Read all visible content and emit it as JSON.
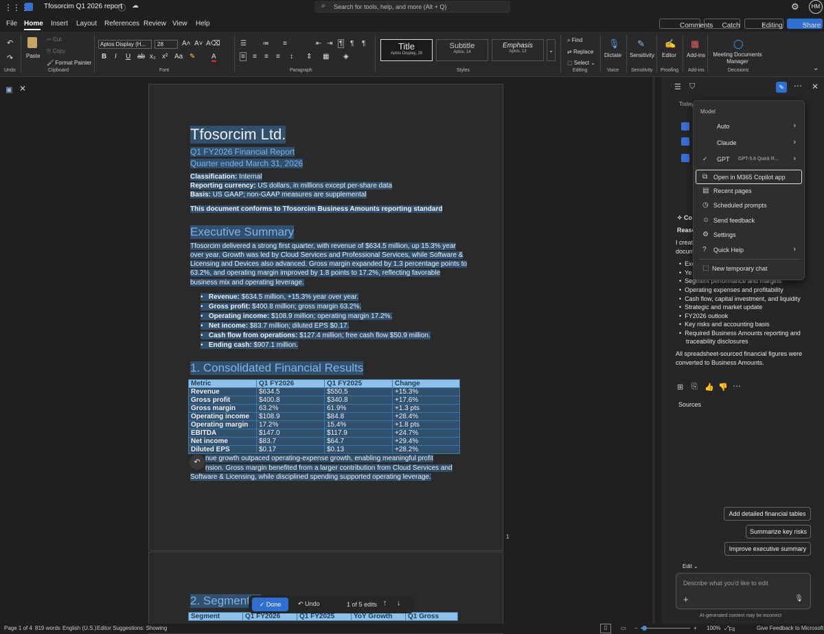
{
  "app": {
    "title": "Tfosorcim Q1 2026 report",
    "search_placeholder": "Search for tools, help, and more (Alt + Q)",
    "user_initials": "HM"
  },
  "menu": {
    "tabs": [
      "File",
      "Home",
      "Insert",
      "Layout",
      "References",
      "Review",
      "View",
      "Help"
    ],
    "comments": "Comments",
    "catch_up": "Catch up",
    "editing": "Editing",
    "share": "Share"
  },
  "ribbon": {
    "undo": "Undo",
    "paste": "Paste",
    "cut": "Cut",
    "copy": "Copy",
    "format_painter": "Format Painter",
    "clipboard": "Clipboard",
    "font_name": "Aptos Display (H...",
    "font_size": "28",
    "font": "Font",
    "paragraph": "Paragraph",
    "style_title": "Title",
    "style_title_sub": "Aptos Display, 28",
    "style_subtitle": "Subtitle",
    "style_subtitle_sub": "Aptos, 14",
    "style_emphasis": "Emphasis",
    "style_emphasis_sub": "Aptos, 12",
    "styles": "Styles",
    "find": "Find",
    "replace": "Replace",
    "select": "Select",
    "editing": "Editing",
    "dictate": "Dictate",
    "voice": "Voice",
    "sensitivity": "Sensitivity",
    "sensitivity_grp": "Sensitivity",
    "editor": "Editor",
    "proofing": "Proofing",
    "addins": "Add-ins",
    "addins_grp": "Add-ins",
    "meeting": "Meeting Documents Manager",
    "decisions": "Decisions"
  },
  "doc": {
    "title": "Tfosorcim Ltd.",
    "subtitle1": "Q1 FY2026 Financial Report",
    "subtitle2": "Quarter ended March 31, 2026",
    "meta": [
      {
        "k": "Classification:",
        "v": " Internal"
      },
      {
        "k": "Reporting currency:",
        "v": " US dollars, in millions except per-share data"
      },
      {
        "k": "Basis:",
        "v": " US GAAP; non-GAAP measures are supplemental"
      }
    ],
    "conform": "This document conforms to Tfosorcim Business Amounts reporting standard",
    "h_exec": "Executive Summary",
    "exec_lines": [
      "Tfosorcim delivered a strong first quarter, with revenue of $634.5 million, up 15.3% year",
      "over year. Growth was led by Cloud Services and Professional Services, while Software &",
      "Licensing and Devices also advanced. Gross margin expanded by 1.3 percentage points to",
      "63.2%, and operating margin improved by 1.8 points to 17.2%, reflecting favorable",
      "business mix and operating leverage."
    ],
    "bullets": [
      {
        "k": "Revenue:",
        "v": " $634.5 million, +15.3% year over year."
      },
      {
        "k": "Gross profit:",
        "v": " $400.8 million; gross margin 63.2%."
      },
      {
        "k": "Operating income:",
        "v": " $108.9 million; operating margin 17.2%."
      },
      {
        "k": "Net income:",
        "v": " $83.7 million; diluted EPS $0.17."
      },
      {
        "k": "Cash flow from operations:",
        "v": " $127.4 million; free cash flow $50.9 million."
      },
      {
        "k": "Ending cash:",
        "v": " $907.1 million."
      }
    ],
    "h_cons": "1. Consolidated Financial Results",
    "table_header": [
      "Metric",
      "Q1 FY2026",
      "Q1 FY2025",
      "Change"
    ],
    "table_rows": [
      [
        "Revenue",
        "$634.5",
        "$550.5",
        "+15.3%"
      ],
      [
        "Gross profit",
        "$400.8",
        "$340.8",
        "+17.6%"
      ],
      [
        "Gross margin",
        "63.2%",
        "61.9%",
        "+1.3 pts"
      ],
      [
        "Operating income",
        "$108.9",
        "$84.8",
        "+28.4%"
      ],
      [
        "Operating margin",
        "17.2%",
        "15.4%",
        "+1.8 pts"
      ],
      [
        "EBITDA",
        "$147.0",
        "$117.9",
        "+24.7%"
      ],
      [
        "Net income",
        "$83.7",
        "$64.7",
        "+29.4%"
      ],
      [
        "Diluted EPS",
        "$0.17",
        "$0.13",
        "+28.2%"
      ]
    ],
    "after_lines": [
      "nue growth outpaced operating-expense growth, enabling meaningful profit",
      "nsion. Gross margin benefited from a larger contribution from Cloud Services and",
      "Software & Licensing, while disciplined spending supported operating leverage."
    ],
    "page_num": "1",
    "h_seg": "2. Segment P",
    "seg_header": [
      "Segment",
      "Q1 FY2026",
      "Q1 FY2025",
      "YoY Growth",
      "Q1 Gross"
    ]
  },
  "edits": {
    "done": "Done",
    "undo": "Undo",
    "count": "1 of 5 edits"
  },
  "pane": {
    "today": "Today",
    "co": "Co",
    "reaso": "Reaso",
    "icrea": "I creat",
    "docum": "docum",
    "list": [
      "Exe",
      "Ye",
      "Segment performance and margins",
      "Operating expenses and profitability",
      "Cash flow, capital investment, and liquidity",
      "Strategic and market update",
      "FY2026 outlook",
      "Key risks and accounting basis",
      "Required Business Amounts reporting and",
      "traceability disclosures"
    ],
    "all_sheet": [
      "All spreadsheet-sourced financial figures were",
      "converted to Business Amounts."
    ],
    "sources": "Sources",
    "sugg": [
      "Add detailed financial tables",
      "Summarize key risks",
      "Improve executive summary"
    ],
    "edit": "Edit",
    "placeholder": "Describe what you'd like to edit",
    "disclaimer": "AI-generated content may be incorrect"
  },
  "dropdown": {
    "model": "Model",
    "auto": "Auto",
    "claude": "Claude",
    "gpt": "GPT",
    "gpt_sub": "GPT-5.6 Quick R...",
    "open": "Open in M365 Copilot app",
    "recent": "Recent pages",
    "scheduled": "Scheduled prompts",
    "feedback": "Send feedback",
    "settings": "Settings",
    "quickhelp": "Quick Help",
    "newchat": "New temporary chat"
  },
  "status": {
    "page": "Page 1 of 4",
    "words": "819 words",
    "lang": "English (U.S.)",
    "editor": "Editor Suggestions: Showing",
    "zoom": "100%",
    "fit": "Fit",
    "feedback": "Give Feedback to Microsoft"
  },
  "colors": {
    "accent": "#4a8fd6",
    "selection": "#30506e",
    "header_row": "#8fc1e8"
  }
}
